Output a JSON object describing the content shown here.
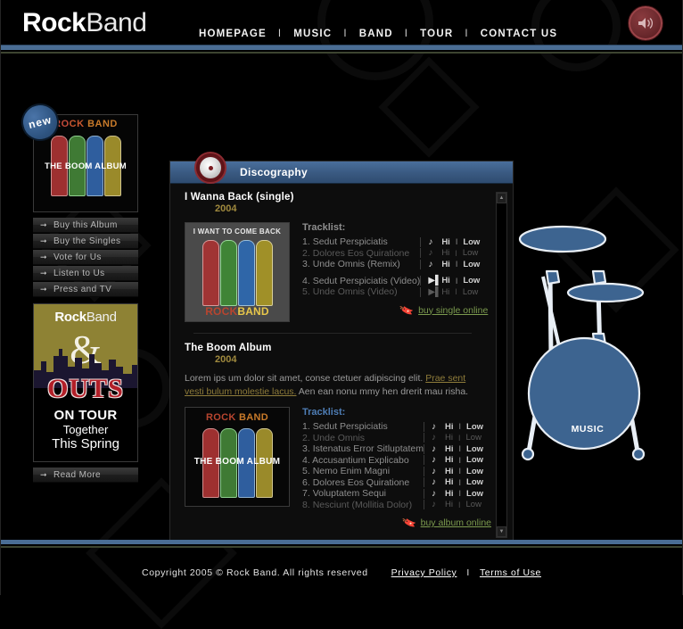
{
  "header": {
    "logo_part1": "Rock",
    "logo_part2": "Band",
    "nav": [
      {
        "label": "HOMEPAGE"
      },
      {
        "label": "MUSIC"
      },
      {
        "label": "BAND"
      },
      {
        "label": "TOUR"
      },
      {
        "label": "CONTACT US"
      }
    ],
    "nav_separator": "I",
    "speaker_icon": "speaker-icon"
  },
  "sidebar": {
    "new_badge": "new",
    "album_thumb": {
      "top_text": "ROCK BAND",
      "overlay_text": "THE BOOM ALBUM"
    },
    "buttons": [
      {
        "label": "Buy this Album"
      },
      {
        "label": "Buy the Singles"
      },
      {
        "label": "Vote for Us"
      },
      {
        "label": "Listen to Us"
      },
      {
        "label": "Press and TV"
      }
    ],
    "tour_banner": {
      "logo_part1": "Rock",
      "logo_part2": "Band",
      "ampersand": "&",
      "outs": "OUTS",
      "line1": "ON TOUR",
      "line2": "Together",
      "line3": "This Spring"
    },
    "read_more": "Read More"
  },
  "panel": {
    "title": "Discography",
    "cd_icon": "cd-disc-icon",
    "scrollbar": {
      "up": "▲",
      "down": "▼"
    },
    "releases": [
      {
        "title": "I Wanna Back (single)",
        "year": "2004",
        "description": null,
        "cover": {
          "top_text": "I WANT TO COME BACK",
          "bottom_text": "ROCKBAND"
        },
        "tracklist_label": "Tracklist:",
        "tracklist_label_color": "#8e8e8e",
        "tracks": [
          {
            "num": "1.",
            "name": "Sedut Perspiciatis",
            "glyph": "note",
            "hi": "Hi",
            "low": "Low",
            "active": true,
            "gap_before": false
          },
          {
            "num": "2.",
            "name": "Dolores Eos Quiratione",
            "glyph": "note",
            "hi": "Hi",
            "low": "Low",
            "active": false,
            "gap_before": false
          },
          {
            "num": "3.",
            "name": "Unde Omnis (Remix)",
            "glyph": "note",
            "hi": "Hi",
            "low": "Low",
            "active": true,
            "gap_before": false
          },
          {
            "num": "4.",
            "name": "Sedut Perspiciatis (Video)",
            "glyph": "video",
            "hi": "Hi",
            "low": "Low",
            "active": true,
            "gap_before": true
          },
          {
            "num": "5.",
            "name": "Unde Omnis (Video)",
            "glyph": "video",
            "hi": "Hi",
            "low": "Low",
            "active": false,
            "gap_before": false
          }
        ],
        "buy_label": "buy single online",
        "buy_icon": "tag-icon"
      },
      {
        "title": "The Boom Album",
        "year": "2004",
        "description_pre": "Lorem ips um dolor sit amet, conse ctetuer adipiscing elit. ",
        "description_link": "Prae sent vesti bulum molestie lacus.",
        "description_post": " Aen ean nonu mmy hen drerit mau risha.",
        "cover": {
          "top_text": "ROCK BAND",
          "overlay_text": "THE BOOM ALBUM"
        },
        "tracklist_label": "Tracklist:",
        "tracklist_label_color": "#4e7db5",
        "tracks": [
          {
            "num": "1.",
            "name": "Sedut Perspiciatis",
            "glyph": "note",
            "hi": "Hi",
            "low": "Low",
            "active": true,
            "gap_before": false
          },
          {
            "num": "2.",
            "name": "Unde Omnis",
            "glyph": "note",
            "hi": "Hi",
            "low": "Low",
            "active": false,
            "gap_before": false
          },
          {
            "num": "3.",
            "name": "Istenatus Error Sitluptatem",
            "glyph": "note",
            "hi": "Hi",
            "low": "Low",
            "active": true,
            "gap_before": false
          },
          {
            "num": "4.",
            "name": "Accusantium  Explicabo",
            "glyph": "note",
            "hi": "Hi",
            "low": "Low",
            "active": true,
            "gap_before": false
          },
          {
            "num": "5.",
            "name": "Nemo Enim Magni",
            "glyph": "note",
            "hi": "Hi",
            "low": "Low",
            "active": true,
            "gap_before": false
          },
          {
            "num": "6.",
            "name": "Dolores Eos Quiratione",
            "glyph": "note",
            "hi": "Hi",
            "low": "Low",
            "active": true,
            "gap_before": false
          },
          {
            "num": "7.",
            "name": "Voluptatem Sequi",
            "glyph": "note",
            "hi": "Hi",
            "low": "Low",
            "active": true,
            "gap_before": false
          },
          {
            "num": "8.",
            "name": "Nesciunt (Mollitia Dolor)",
            "glyph": "note",
            "hi": "Hi",
            "low": "Low",
            "active": false,
            "gap_before": false
          }
        ],
        "buy_label": "buy album online",
        "buy_icon": "tag-icon"
      }
    ]
  },
  "drums": {
    "label": "MUSIC",
    "icon": "drum-kit-icon"
  },
  "footer": {
    "copyright": "Copyright 2005 ©  Rock Band. All rights reserved",
    "privacy_label": "Privacy Policy",
    "separator": "I",
    "terms_label": "Terms of Use"
  },
  "colors": {
    "accent_blue": "#4a6d94",
    "panel_header_blue": "#3a5a82",
    "year_gold": "#a08a3e",
    "buy_link_green": "#7b9a4e",
    "desc_link_gold": "#8f7c3a",
    "speaker_red": "#6e2b2f",
    "drum_blue": "#3d6490",
    "tour_olive": "#8e8234",
    "outs_red": "#b21f28"
  }
}
